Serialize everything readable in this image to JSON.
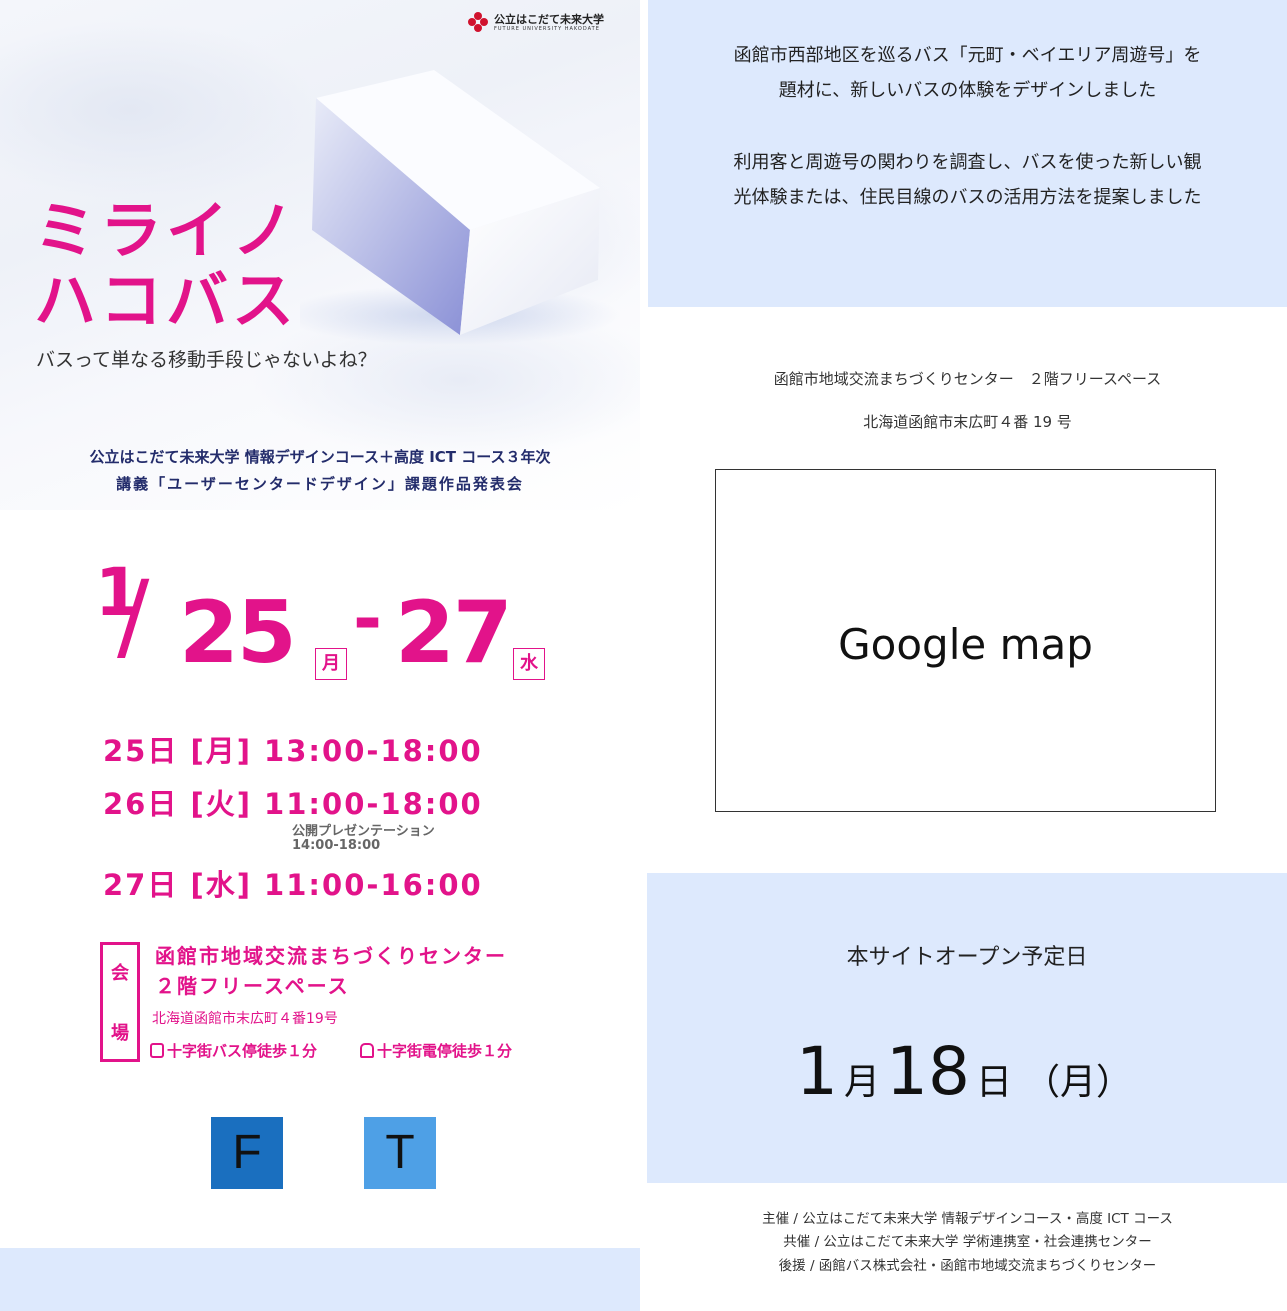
{
  "hero": {
    "university_logo": {
      "name": "公立はこだて未来大学",
      "english": "FUTURE UNIVERSITY HAKODATE"
    },
    "title_line1": "ミライノ",
    "title_line2": "ハコバス",
    "tagline": "バスって単なる移動手段じゃないよね？",
    "course_line1": "公立はこだて未来大学 情報デザインコース＋高度 ICT コース３年次",
    "course_line2": "講義「ユーザーセンタードデザイン」課題作品発表会"
  },
  "event_date": {
    "month": "1",
    "slash": "/",
    "start_day": "25",
    "start_weekday": "月",
    "dash": "-",
    "end_day": "27",
    "end_weekday": "水"
  },
  "schedule": [
    {
      "text": "25日 [月] 13:00-18:00"
    },
    {
      "text": "26日 [火] 11:00-18:00",
      "note_title": "公開プレゼンテーション",
      "note_time": "14:00-18:00"
    },
    {
      "text": "27日 [水] 11:00-16:00"
    }
  ],
  "venue": {
    "label_top": "会",
    "label_bottom": "場",
    "name_line1": "函館市地域交流まちづくりセンター",
    "name_line2": "２階フリースペース",
    "address": "北海道函館市末広町４番19号",
    "access_bus": "十字街バス停徒歩１分",
    "access_tram": "十字街電停徒歩１分"
  },
  "social": {
    "facebook_label": "F",
    "twitter_label": "T",
    "facebook_icon": "facebook-icon",
    "twitter_icon": "twitter-icon"
  },
  "intro": {
    "line1": "函館市西部地区を巡るバス「元町・ベイエリア周遊号」を",
    "line2": "題材に、新しいバスの体験をデザインしました",
    "line3": "利用客と周遊号の関わりを調査し、バスを使った新しい観",
    "line4": "光体験または、住民目線のバスの活用方法を提案しました"
  },
  "venue_right": {
    "line1": "函館市地域交流まちづくりセンター　２階フリースペース",
    "line2": "北海道函館市末広町４番 19 号"
  },
  "map": {
    "label": "Google map"
  },
  "site_open": {
    "label": "本サイトオープン予定日",
    "month": "1",
    "month_unit": "月",
    "day": "18",
    "day_unit": "日",
    "weekday": "（月）"
  },
  "credits": {
    "host": "主催 / 公立はこだて未来大学 情報デザインコース・高度 ICT コース",
    "cohost": "共催 / 公立はこだて未来大学 学術連携室・社会連携センター",
    "support": "後援 / 函館バス株式会社・函館市地域交流まちづくりセンター"
  },
  "colors": {
    "accent_pink": "#e2138a",
    "navy": "#232c6b",
    "panel_blue": "#dde9fd",
    "facebook_blue": "#1a6fbf",
    "twitter_blue": "#4ea0e6",
    "logo_red": "#d0122e"
  }
}
